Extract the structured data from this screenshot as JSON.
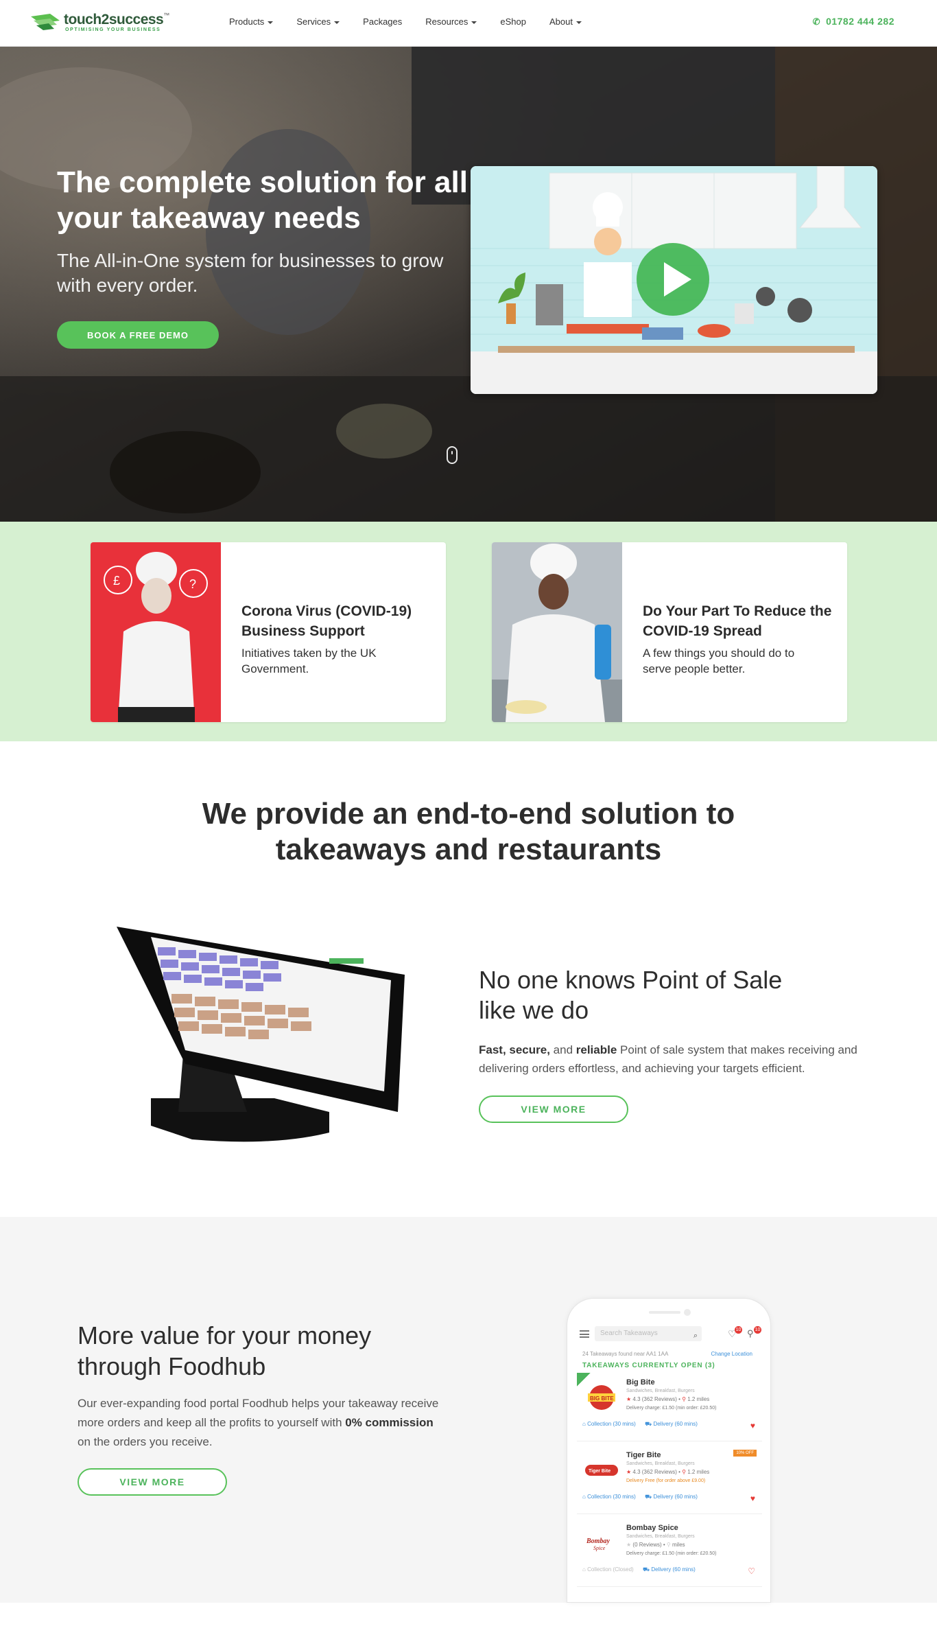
{
  "header": {
    "logo_name": "touch2success",
    "logo_tagline": "OPTIMISING YOUR BUSINESS",
    "nav": [
      {
        "label": "Products",
        "dropdown": true
      },
      {
        "label": "Services",
        "dropdown": true
      },
      {
        "label": "Packages",
        "dropdown": false
      },
      {
        "label": "Resources",
        "dropdown": true
      },
      {
        "label": "eShop",
        "dropdown": false
      },
      {
        "label": "About",
        "dropdown": true
      }
    ],
    "phone": "01782 444 282",
    "phone_icon": "phone-icon",
    "accent_color": "#4cb35c"
  },
  "hero": {
    "title": "The complete solution for all your takeaway needs",
    "subtitle": "The All-in-One system for businesses to grow with every order.",
    "cta": "BOOK A FREE DEMO",
    "video_icon": "play-icon"
  },
  "covid": {
    "cards": [
      {
        "title": "Corona Virus (COVID-19) Business Support",
        "text": "Initiatives taken by the UK Government."
      },
      {
        "title": "Do Your Part To Reduce the COVID-19 Spread",
        "text": "A few things you should do to serve people better."
      }
    ],
    "band_color": "#d6f0d1"
  },
  "solution": {
    "title": "We provide an end-to-end solution to takeaways and restaurants"
  },
  "pos": {
    "heading": "No one knows Point of Sale like we do",
    "text_b1": "Fast, secure,",
    "text_1": " and ",
    "text_b2": "reliable",
    "text_2": " Point of sale system that makes receiving and delivering orders effortless, and achieving your targets efficient.",
    "button": "VIEW MORE"
  },
  "foodhub": {
    "heading": "More value for your money through Foodhub",
    "text_1": "Our ever-expanding food portal Foodhub helps your takeaway receive more orders and keep all the profits to yourself with ",
    "text_b1": "0% commission",
    "text_2": " on the orders you receive.",
    "button": "VIEW MORE"
  },
  "app": {
    "search_placeholder": "Search Takeaways",
    "fav_badge": "10",
    "filter_badge": "10",
    "found": "24 Takeaways found near AA1 1AA",
    "change_location": "Change Location",
    "open_label": "TAKEAWAYS CURRENTLY OPEN (3)",
    "restaurants": [
      {
        "name": "Big Bite",
        "cuisine": "Sandwiches, Breakfast, Burgers",
        "rating": "4.3",
        "reviews": "(362 Reviews)",
        "distance": "1.2 miles",
        "delivery": "Delivery charge: £1.50 (min order: £20.50)",
        "collection": "Collection",
        "collection_time": "(30 mins)",
        "delivery_label": "Delivery",
        "delivery_time": "(60 mins)",
        "badge": ""
      },
      {
        "name": "Tiger Bite",
        "cuisine": "Sandwiches, Breakfast, Burgers",
        "rating": "4.3",
        "reviews": "(362 Reviews)",
        "distance": "1.2 miles",
        "delivery": "Delivery Free (for order above £9.00)",
        "collection": "Collection",
        "collection_time": "(30 mins)",
        "delivery_label": "Delivery",
        "delivery_time": "(60 mins)",
        "badge": "10% OFF"
      },
      {
        "name": "Bombay Spice",
        "cuisine": "Sandwiches, Breakfast, Burgers",
        "rating": "",
        "reviews": "(0 Reviews)",
        "distance": "miles",
        "delivery": "Delivery charge: £1.50 (min order: £20.50)",
        "collection": "Collection",
        "collection_time": "(Closed)",
        "delivery_label": "Delivery",
        "delivery_time": "(60 mins)",
        "badge": ""
      }
    ]
  }
}
